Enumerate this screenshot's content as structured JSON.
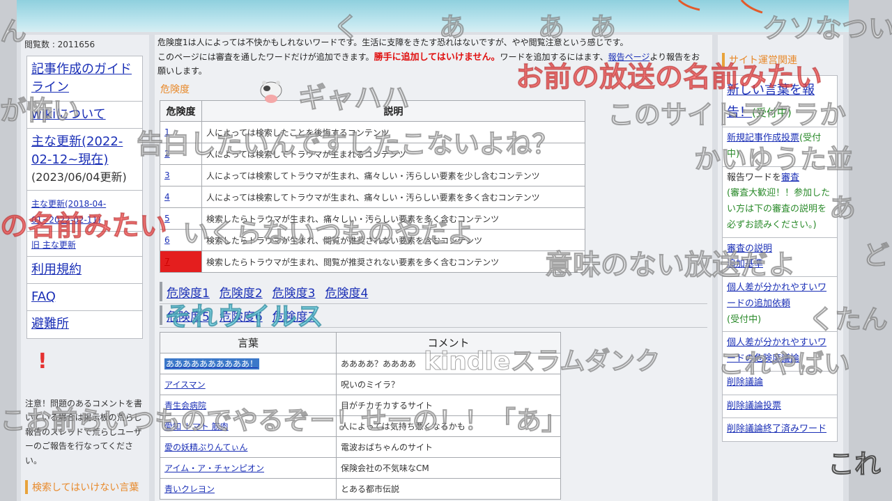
{
  "page": {
    "views": "閲覧数 : 2011656"
  },
  "left_nav": [
    {
      "label": "記事作成のガイドライン",
      "size": "big"
    },
    {
      "label": "wikiについて",
      "size": "big"
    },
    {
      "label": "主な更新(2022-02-12~現在)",
      "size": "big",
      "note": "(2023/06/04更新)"
    },
    {
      "label": "主な更新(2018-04-01~2022-02-11)",
      "size": "sm"
    },
    {
      "label": "旧 主な更新",
      "size": "sm"
    },
    {
      "label": "利用規約",
      "size": "big"
    },
    {
      "label": "FAQ",
      "size": "big"
    },
    {
      "label": "避難所",
      "size": "big"
    }
  ],
  "left_notice": "注意！問題のあるコメントを書いている場合は掲示板の荒らし報告のスレッドで荒らしユーザーのご報告を行なってください。",
  "left_section": "検索してはいけない言葉",
  "intro": {
    "line1": "危険度1は人によっては不快かもしれないワードです。生活に支障をきたす恐れはないですが、やや閲覧注意という感じです。",
    "line2_pre": "このページには審査を通したワードだけが追加できます。",
    "line2_red": "勝手に追加してはいけません。",
    "line2_post": "ワードを追加するにはます、",
    "report_link": "報告ページ",
    "line3": "より報告をお願いします。"
  },
  "section_title": "危険度",
  "danger_table": {
    "headers": [
      "危険度",
      "説明"
    ],
    "rows": [
      {
        "level": "1",
        "desc": "人によっては検索したことを後悔するコンテンツ"
      },
      {
        "level": "2",
        "desc": "人によっては検索してトラウマが生まれるコンテンツ"
      },
      {
        "level": "3",
        "desc": "人によっては検索してトラウマが生まれ、痛々しい・汚らしい要素を少し含むコンテンツ"
      },
      {
        "level": "4",
        "desc": "人によっては検索してトラウマが生まれ、痛々しい・汚らしい要素を多く含むコンテンツ"
      },
      {
        "level": "5",
        "desc": "検索したらトラウマが生まれ、痛々しい・汚らしい要素を多く含むコンテンツ"
      },
      {
        "level": "6",
        "desc": "検索したらトラウマが生まれ、閲覧が推奨されない要素を含むコンテンツ"
      },
      {
        "level": "7",
        "desc": "検索したらトラウマが生まれ、閲覧が推奨されない要素を多く含むコンテンツ"
      }
    ]
  },
  "level_links_1": [
    "危険度1",
    "危険度2",
    "危険度3",
    "危険度4"
  ],
  "level_links_2": [
    "危険度5",
    "危険度6",
    "危険度7"
  ],
  "word_table": {
    "headers": [
      "言葉",
      "コメント"
    ],
    "rows": [
      {
        "word": "ああああああああああ！",
        "comment": "ああああ？ああああ"
      },
      {
        "word": "アイスマン",
        "comment": "呪いのミイラ？"
      },
      {
        "word": "青生会病院",
        "comment": "目がチカチカするサイト"
      },
      {
        "word": "愛知 トマト 筋肉",
        "comment": "人によっては気持ち悪くなるかも"
      },
      {
        "word": "愛の妖精ぷりんてぃん",
        "comment": "電波おばちゃんのサイト"
      },
      {
        "word": "アイム・ア・チャンピオン",
        "comment": "保険会社の不気味なCM"
      },
      {
        "word": "青いクレヨン",
        "comment": "とある都市伝説"
      }
    ]
  },
  "right_title": "サイト運営関連",
  "right_nav": [
    {
      "link": "新しい言葉を報告！",
      "tail": "(受付中)",
      "tail_style": "g",
      "size": "big"
    },
    {
      "link": "新規記事作成投票",
      "tail": "(受付中)",
      "tail_style": "g"
    },
    {
      "pre": "報告ワードを",
      "link": "審査",
      "tail": "(審査大歓迎！！参加したい方は下の審査の説明を必ずお読みください。)",
      "tail_style": "g"
    },
    {
      "link": "審査の説明",
      "link2": "追加基準"
    },
    {
      "link": "個人差が分かれやすいワードの追加依頼",
      "tail": "(受付中)",
      "tail_style": "g"
    },
    {
      "link": "個人差が分かれやすいワードの危険度議論"
    },
    {
      "link": "削除議論"
    },
    {
      "link": "削除議論投票"
    },
    {
      "link": "削除議論終了済みワード"
    }
  ],
  "comments": [
    {
      "text": "く",
      "style": "normal"
    },
    {
      "text": "あ",
      "style": "normal"
    },
    {
      "text": "あ",
      "style": "normal"
    },
    {
      "text": "あ",
      "style": "normal"
    },
    {
      "text": "クソなつい",
      "style": "normal"
    },
    {
      "text": "ん",
      "style": "normal"
    },
    {
      "text": "ギャハハ",
      "style": "normal"
    },
    {
      "text": "お前の放送の名前みたい",
      "style": "red"
    },
    {
      "text": "このサイトラクラか",
      "style": "normal"
    },
    {
      "text": "が怖い",
      "style": "normal"
    },
    {
      "text": "告白したいんですしたこないよね？",
      "style": "normal"
    },
    {
      "text": "かいゆうた並",
      "style": "normal"
    },
    {
      "text": "の名前みたい",
      "style": "red"
    },
    {
      "text": "あ",
      "style": "normal"
    },
    {
      "text": "いくらないつものやだよ",
      "style": "normal"
    },
    {
      "text": "意味のない放送だよ",
      "style": "normal"
    },
    {
      "text": "どこ",
      "style": "normal"
    },
    {
      "text": "それウイルス",
      "style": "cyan"
    },
    {
      "text": "くたん",
      "style": "normal"
    },
    {
      "text": "kindleスラムダンク",
      "style": "normal"
    },
    {
      "text": "これやばい",
      "style": "normal"
    },
    {
      "text": "こお前らいつものでやるぞー！せーの！！「あ」",
      "style": "normal"
    },
    {
      "text": "これ",
      "style": "dark"
    }
  ]
}
